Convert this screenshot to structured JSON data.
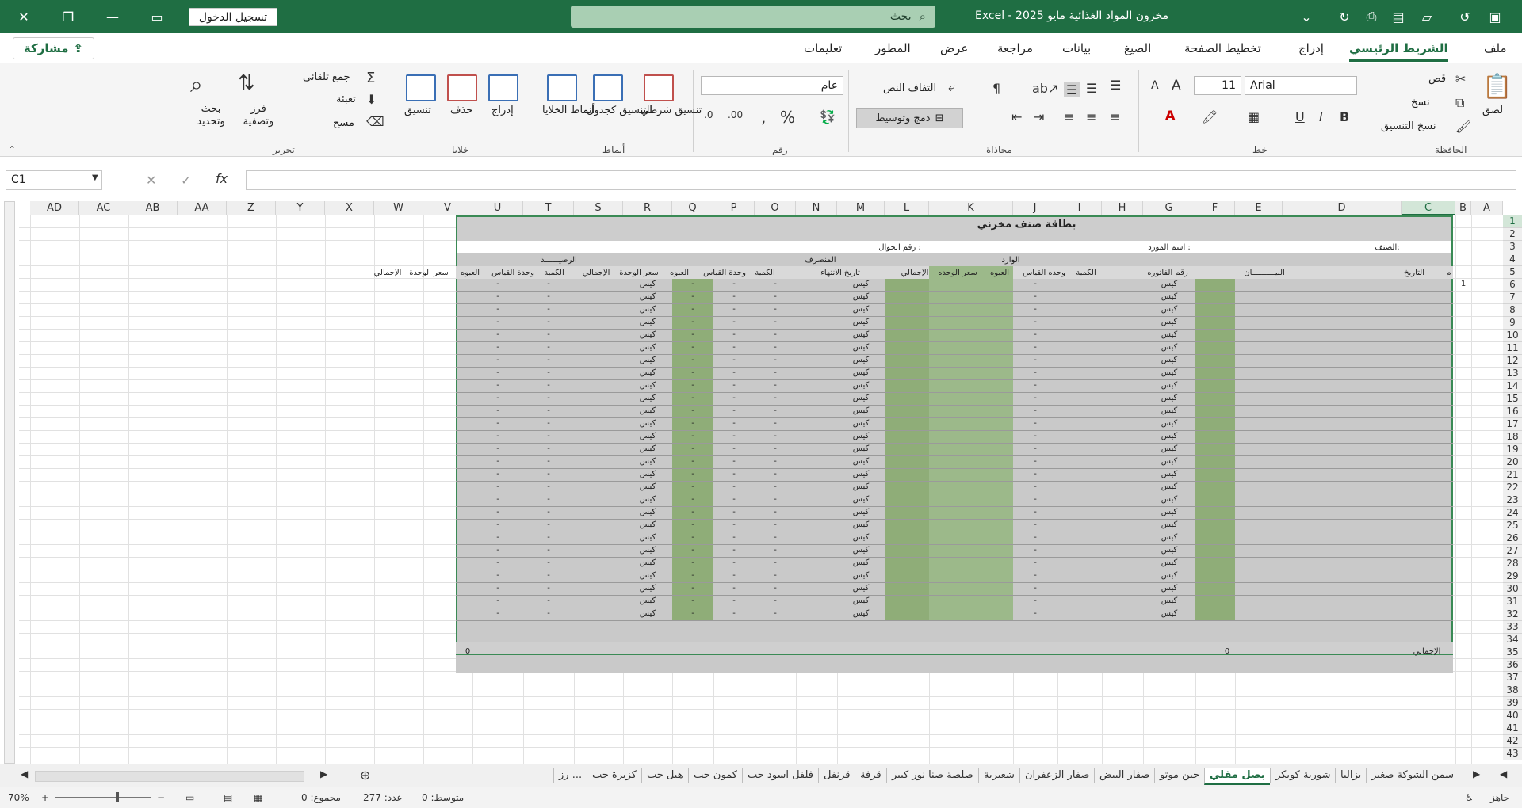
{
  "window": {
    "title": "مخزون المواد الغذائية مايو 2025  -  Excel",
    "signin_label": "تسجيل الدخول",
    "search_placeholder": "بحث"
  },
  "menu": {
    "share_label": "مشاركة",
    "tabs": [
      "ملف",
      "الشريط الرئيسي",
      "إدراج",
      "تخطيط الصفحة",
      "الصيغ",
      "بيانات",
      "مراجعة",
      "عرض",
      "المطور",
      "تعليمات"
    ],
    "active_tab": "الشريط الرئيسي"
  },
  "ribbon": {
    "clipboard": {
      "label": "الحافظة",
      "paste": "لصق",
      "cut": "قص",
      "copy": "نسخ",
      "format_painter": "نسخ التنسيق"
    },
    "font": {
      "label": "خط",
      "font_name": "Arial",
      "font_size": "11"
    },
    "alignment": {
      "label": "محاذاة",
      "wrap_text": "التفاف النص",
      "merge_center": "دمج وتوسيط"
    },
    "number": {
      "label": "رقم",
      "format": "عام"
    },
    "styles": {
      "label": "أنماط",
      "conditional": "تنسيق شرطي",
      "format_table": "التنسيق كجدول",
      "cell_styles": "أنماط الخلايا"
    },
    "cells": {
      "label": "خلايا",
      "insert": "إدراج",
      "delete": "حذف",
      "format": "تنسيق"
    },
    "editing": {
      "label": "تحرير",
      "autosum": "جمع تلقائي",
      "fill": "تعبئة",
      "clear": "مسح",
      "sort_filter": "فرز وتصفية",
      "find_select": "بحث وتحديد"
    }
  },
  "formula_bar": {
    "name_box": "C1",
    "fx": "fx",
    "formula": ""
  },
  "columns": [
    "A",
    "B",
    "C",
    "D",
    "E",
    "F",
    "G",
    "H",
    "I",
    "J",
    "K",
    "L",
    "M",
    "N",
    "O",
    "P",
    "Q",
    "R",
    "S",
    "T",
    "U",
    "V",
    "W",
    "X",
    "Y",
    "Z",
    "AA",
    "AB",
    "AC",
    "AD"
  ],
  "rows": [
    "1",
    "2",
    "3",
    "4",
    "5",
    "6",
    "7",
    "8",
    "9",
    "10",
    "11",
    "12",
    "13",
    "14",
    "15",
    "16",
    "17",
    "18",
    "19",
    "20",
    "21",
    "22",
    "23",
    "24",
    "25",
    "26",
    "27",
    "28",
    "29",
    "30",
    "31",
    "32",
    "33",
    "34",
    "35",
    "36",
    "37",
    "38",
    "39",
    "40",
    "41",
    "42",
    "43"
  ],
  "sheet": {
    "title": "بطاقة صنف مخزني",
    "item_label": "الصنف:",
    "supplier_label": "اسم المورد :",
    "mobile_label": "رقم الجوال :",
    "sections": {
      "incoming": "الوارد",
      "outgoing": "المنصرف",
      "balance": "الرصيــــــد"
    },
    "headers": {
      "seq": "م",
      "date": "التاريخ",
      "statement": "البيــــــــــان",
      "invoice": "رقم الفاتوره",
      "qty": "الكمية",
      "unit": "وحده القياس",
      "pack": "العبوه",
      "unit_price": "سعر الوحده",
      "total": "الإجمالي",
      "expiry": "تاريخ الانتهاء",
      "unit2": "وحدة القياس",
      "unit_price2": "سعر الوحدة"
    },
    "unit_value": "كيس",
    "dash": "-",
    "first_seq": "1",
    "total_label": "الإجمالي",
    "total_in_qty": "0",
    "total_out_qty": "0"
  },
  "sheet_tabs": [
    "سمن الشوكة صغير",
    "بزاليا",
    "شوربة كويكر",
    "بصل مقلي",
    "جبن موتو",
    "صفار البيض",
    "صفار الزعفران",
    "شعيرية",
    "صلصة صنا نور كبير",
    "قرفة",
    "قرنفل",
    "فلفل اسود حب",
    "كمون حب",
    "هيل حب",
    "كزبرة حب",
    "رز ..."
  ],
  "active_sheet_tab": "بصل مقلي",
  "status": {
    "ready": "جاهز",
    "average": "متوسط: 0",
    "count": "عدد: 277",
    "sum": "مجموع: 0",
    "zoom": "70%"
  }
}
